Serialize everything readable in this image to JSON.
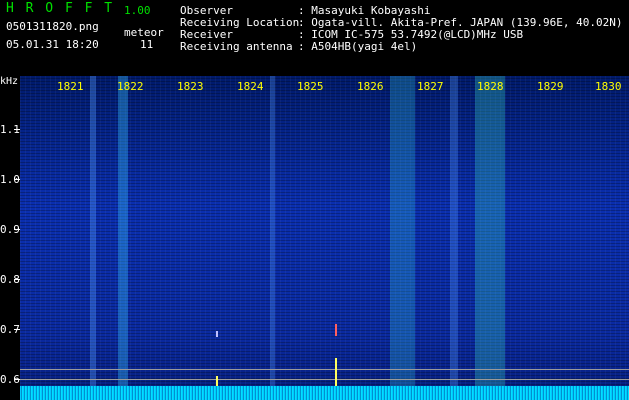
{
  "header": {
    "app_title": "H R O F F T",
    "version": "1.00",
    "filename": "0501311820.png",
    "datetime": "05.01.31 18:20",
    "meteor_label": "meteor",
    "meteor_count": "11",
    "fields": [
      {
        "label": "Observer",
        "value": ": Masayuki Kobayashi"
      },
      {
        "label": "Receiving Location",
        "value": ": Ogata-vill. Akita-Pref. JAPAN (139.96E, 40.02N)"
      },
      {
        "label": "Receiver",
        "value": ": ICOM IC-575 53.7492(@LCD)MHz USB"
      },
      {
        "label": "Receiving antenna",
        "value": ": A504HB(yagi 4el)"
      }
    ]
  },
  "plot": {
    "y_unit": "kHz",
    "y_ticks": [
      "1.1",
      "1.0",
      "0.9",
      "0.8",
      "0.7",
      "0.6"
    ],
    "hour_ticks": [
      "1821",
      "1822",
      "1823",
      "1824",
      "1825",
      "1826",
      "1827",
      "1828",
      "1829",
      "1830"
    ],
    "colors": {
      "background": "#000000",
      "title": "#00e000",
      "hour_labels": "#ffff00",
      "signal": "#00ffff"
    }
  }
}
